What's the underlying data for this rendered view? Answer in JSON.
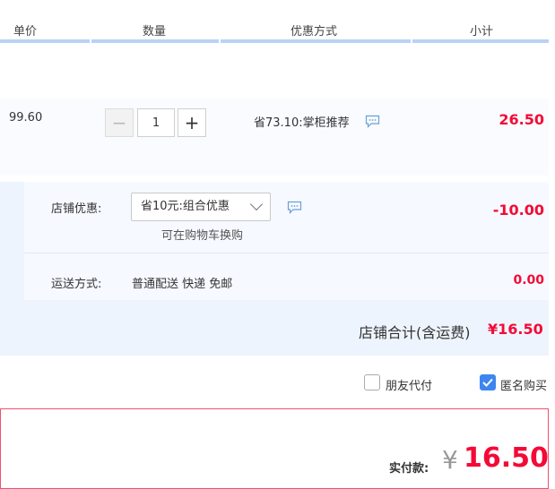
{
  "header": {
    "col_price": "单价",
    "col_qty": "数量",
    "col_promo": "优惠方式",
    "col_subtotal": "小计"
  },
  "item": {
    "price": "99.60",
    "qty_minus": "−",
    "qty_value": "1",
    "qty_plus": "+",
    "promo_text": "省73.10:掌柜推荐",
    "promo_icon": "message-icon",
    "subtotal": "26.50"
  },
  "shop": {
    "discount_label": "店铺优惠:",
    "discount_selected": "省10元:组合优惠",
    "discount_icon": "message-icon",
    "discount_hint": "可在购物车换购",
    "discount_value": "-10.00",
    "shipping_label": "运送方式:",
    "shipping_method": "普通配送 快递 免邮",
    "shipping_value": "0.00",
    "total_label": "店铺合计(含运费)",
    "total_value": "¥16.50"
  },
  "options": {
    "friend_pay_label": "朋友代付",
    "friend_pay_checked": false,
    "anonymous_label": "匿名购买",
    "anonymous_checked": true
  },
  "payment": {
    "label": "实付款:",
    "currency": "¥",
    "amount": "16.50"
  },
  "colors": {
    "accent_red": "#f40a36",
    "header_bar": "#b9d3f3",
    "checkbox_blue": "#3d86f0"
  }
}
